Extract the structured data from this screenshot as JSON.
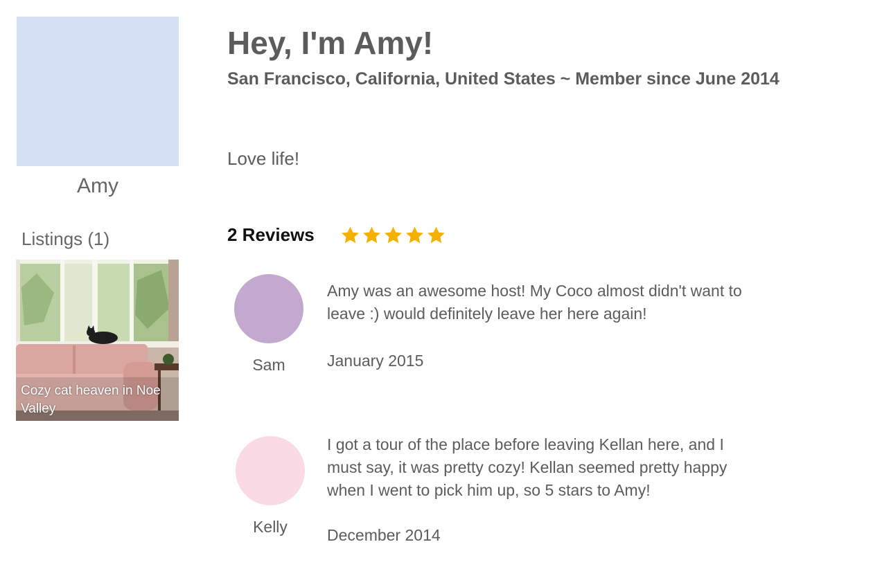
{
  "profile": {
    "name": "Amy",
    "avatar_color": "#d4e0f4",
    "title": "Hey, I'm Amy!",
    "location_line": "San Francisco, California, United States ~ Member since June 2014",
    "bio": "Love life!"
  },
  "listings": {
    "heading": "Listings (1)",
    "items": [
      {
        "caption": "Cozy cat heaven in Noe Valley"
      }
    ]
  },
  "reviews": {
    "heading": "2 Reviews",
    "rating": 5,
    "rating_max": 5,
    "star_color": "#f5b100",
    "items": [
      {
        "reviewer": "Sam",
        "avatar_color": "#c3a9cf",
        "text": "Amy was an awesome host! My Coco almost didn't want to leave :) would definitely leave her here again!",
        "date": "January 2015"
      },
      {
        "reviewer": "Kelly",
        "avatar_color": "#fadae5",
        "text": "I got a tour of the place before leaving Kellan here, and I must say, it was pretty cozy! Kellan seemed pretty happy when I went to pick him up, so 5 stars to Amy!",
        "date": "December 2014"
      }
    ]
  }
}
